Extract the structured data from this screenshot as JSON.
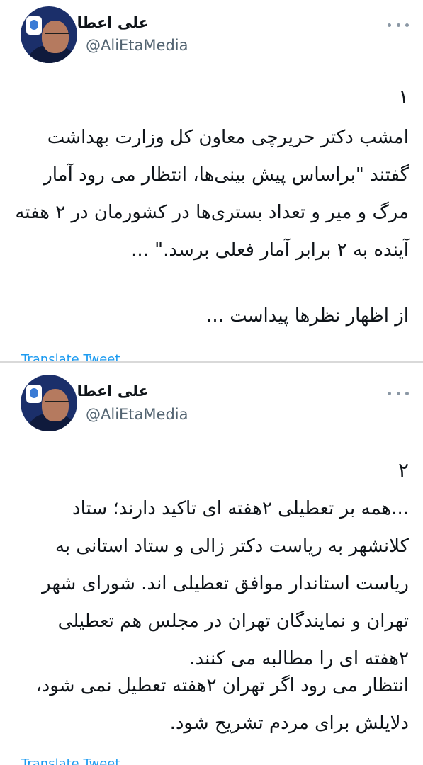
{
  "tweets": [
    {
      "author_name": "علی اعطا",
      "handle": "@AliEtaMedia",
      "number": "۱",
      "paragraphs": [
        "امشب دکتر حریرچی معاون کل وزارت بهداشت گفتند \"براساس پیش بینی‌ها، انتظار می رود آمار مرگ و میر و تعداد بستری‌ها در کشورمان در ۲ هفته آینده به ۲ برابر آمار فعلی برسد.\" ...",
        "از اظهار نظرها پیداست ..."
      ],
      "translate_label": "Translate Tweet"
    },
    {
      "author_name": "علی اعطا",
      "handle": "@AliEtaMedia",
      "number": "۲",
      "paragraphs": [
        "...همه بر تعطیلی ۲هفته ای تاکید دارند؛ ستاد کلانشهر به ریاست دکتر زالی و ستاد استانی به ریاست استاندار موافق تعطیلی اند. شورای شهر تهران و نمایندگان تهران در مجلس هم تعطیلی ۲هفته ای را مطالبه می کنند.",
        "انتظار می رود اگر تهران ۲هفته تعطیل نمی شود، دلایلش برای مردم تشریح شود."
      ],
      "translate_label": "Translate Tweet"
    }
  ],
  "icons": {
    "more": "more-horizontal-icon",
    "avatar": "profile-photo"
  },
  "colors": {
    "handle": "#536471",
    "link": "#1d9bf0",
    "text": "#0f1419"
  }
}
